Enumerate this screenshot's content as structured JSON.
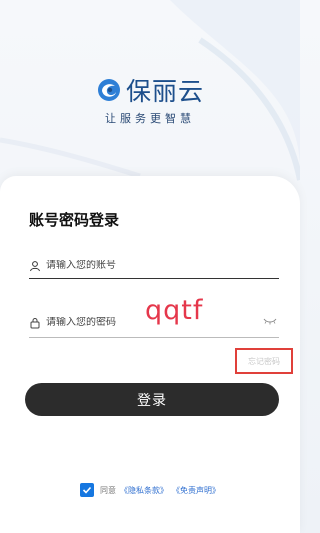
{
  "brand": {
    "name": "保丽云",
    "slogan": "让服务更智慧"
  },
  "login": {
    "title": "账号密码登录",
    "account_placeholder": "请输入您的账号",
    "password_placeholder": "请输入您的密码",
    "annotation_text": "qqtf",
    "forgot_label": "忘记密码",
    "submit_label": "登录"
  },
  "agreement": {
    "checked": true,
    "prefix": "同意",
    "privacy_link": "《隐私条款》",
    "disclaimer_link": "《免责声明》"
  },
  "colors": {
    "brand_blue": "#1d4f8c",
    "button_dark": "#2c2c2c",
    "checkbox_blue": "#1677e0",
    "highlight_red": "#e0403a"
  },
  "icons": [
    "logo-swirl-icon",
    "user-icon",
    "lock-icon",
    "eye-closed-icon",
    "checkmark-icon"
  ]
}
